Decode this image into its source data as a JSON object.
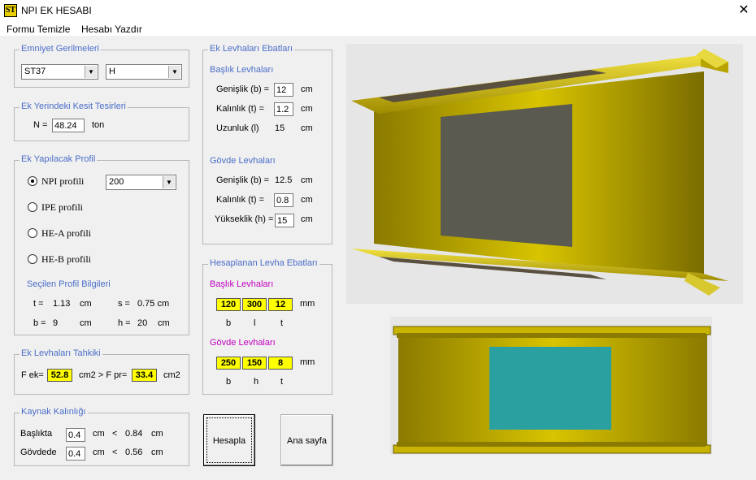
{
  "window": {
    "icon_text": "ST",
    "title": "NPI EK HESABI",
    "close": "✕"
  },
  "menu": {
    "clear": "Formu Temizle",
    "print": "Hesabı Yazdır"
  },
  "emniyet": {
    "title": "Emniyet Gerilmeleri",
    "steel": "ST37",
    "load": "H"
  },
  "kesit": {
    "title": "Ek Yerindeki Kesit Tesirleri",
    "n_label": "N =",
    "n_value": "48.24",
    "n_unit": "ton"
  },
  "profil": {
    "title": "Ek Yapılacak Profil",
    "npi": "NPI profili",
    "ipe": "IPE profili",
    "hea": "HE-A profili",
    "heb": "HE-B profili",
    "size": "200",
    "info_title": "Seçilen Profil Bilgileri",
    "t_label": "t =",
    "t_value": "1.13",
    "t_unit": "cm",
    "s_label": "s =",
    "s_value": "0.75 cm",
    "b_label": "b =",
    "b_value": "9",
    "b_unit": "cm",
    "h_label": "h =",
    "h_value": "20",
    "h_unit": "cm"
  },
  "tahkik": {
    "title": "Ek Levhaları Tahkiki",
    "fek_label": "F ek=",
    "fek_value": "52.8",
    "mid": "cm2 > F pr=",
    "fpr_value": "33.4",
    "unit": "cm2"
  },
  "kaynak": {
    "title": "Kaynak Kalınlığı",
    "baslik_label": "Başlıkta",
    "baslik_value": "0.4",
    "baslik_unit": "cm",
    "baslik_lt": "<",
    "baslik_max": "0.84",
    "baslik_max_unit": "cm",
    "govde_label": "Gövdede",
    "govde_value": "0.4",
    "govde_unit": "cm",
    "govde_lt": "<",
    "govde_max": "0.56",
    "govde_max_unit": "cm"
  },
  "ebat": {
    "title": "Ek Levhaları Ebatları",
    "baslik_title": "Başlık Levhaları",
    "genislik_label": "Genişlik (b) =",
    "genislik_value": "12",
    "genislik_unit": "cm",
    "kalinlik_label": "Kalınlık (t) =",
    "kalinlik_value": "1.2",
    "kalinlik_unit": "cm",
    "uzunluk_label": "Uzunluk (l)",
    "uzunluk_value": "15",
    "uzunluk_unit": "cm",
    "govde_title": "Gövde Levhaları",
    "g_genislik_label": "Genişlik (b) =",
    "g_genislik_value": "12.5",
    "g_genislik_unit": "cm",
    "g_kalinlik_label": "Kalınlık (t) =",
    "g_kalinlik_value": "0.8",
    "g_kalinlik_unit": "cm",
    "yukseklik_label": "Yükseklik (h) =",
    "yukseklik_value": "15",
    "yukseklik_unit": "cm"
  },
  "hesaplanan": {
    "title": "Hesaplanan Levha Ebatları",
    "baslik_title": "Başlık Levhaları",
    "b_values": [
      "120",
      "300",
      "12"
    ],
    "b_labels": [
      "b",
      "l",
      "t"
    ],
    "b_unit": "mm",
    "govde_title": "Gövde Levhaları",
    "g_values": [
      "250",
      "150",
      "8"
    ],
    "g_labels": [
      "b",
      "h",
      "t"
    ],
    "g_unit": "mm"
  },
  "buttons": {
    "hesapla": "Hesapla",
    "ana_sayfa": "Ana sayfa"
  },
  "colors": {
    "group_title": "#4a6dc8",
    "section_title": "#c000c0",
    "result_bg": "#ffff00",
    "beam": "#c8b400",
    "plate_top": "#5a5a50",
    "plate_side": "#2aa0a0"
  }
}
